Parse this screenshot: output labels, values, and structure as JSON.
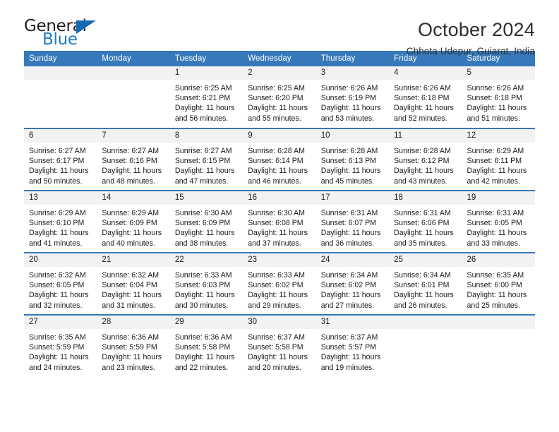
{
  "brand": {
    "name_top": "General",
    "name_bottom": "Blue",
    "accent_color": "#1569b0",
    "text_color": "#231f20"
  },
  "header": {
    "month_title": "October 2024",
    "location": "Chhota Udepur, Gujarat, India"
  },
  "theme": {
    "header_bg": "#3679ba",
    "header_text": "#ffffff",
    "daynum_bg": "#f2f2f2",
    "row_divider": "#3679ba"
  },
  "weekday_headers": [
    "Sunday",
    "Monday",
    "Tuesday",
    "Wednesday",
    "Thursday",
    "Friday",
    "Saturday"
  ],
  "labels": {
    "sunrise_prefix": "Sunrise:",
    "sunset_prefix": "Sunset:",
    "daylight_prefix": "Daylight:"
  },
  "weeks": [
    [
      {
        "day": "",
        "sunrise": "",
        "sunset": "",
        "daylight": "",
        "empty": true
      },
      {
        "day": "",
        "sunrise": "",
        "sunset": "",
        "daylight": "",
        "empty": true
      },
      {
        "day": "1",
        "sunrise": "Sunrise: 6:25 AM",
        "sunset": "Sunset: 6:21 PM",
        "daylight": "Daylight: 11 hours and 56 minutes."
      },
      {
        "day": "2",
        "sunrise": "Sunrise: 6:25 AM",
        "sunset": "Sunset: 6:20 PM",
        "daylight": "Daylight: 11 hours and 55 minutes."
      },
      {
        "day": "3",
        "sunrise": "Sunrise: 6:26 AM",
        "sunset": "Sunset: 6:19 PM",
        "daylight": "Daylight: 11 hours and 53 minutes."
      },
      {
        "day": "4",
        "sunrise": "Sunrise: 6:26 AM",
        "sunset": "Sunset: 6:18 PM",
        "daylight": "Daylight: 11 hours and 52 minutes."
      },
      {
        "day": "5",
        "sunrise": "Sunrise: 6:26 AM",
        "sunset": "Sunset: 6:18 PM",
        "daylight": "Daylight: 11 hours and 51 minutes."
      }
    ],
    [
      {
        "day": "6",
        "sunrise": "Sunrise: 6:27 AM",
        "sunset": "Sunset: 6:17 PM",
        "daylight": "Daylight: 11 hours and 50 minutes."
      },
      {
        "day": "7",
        "sunrise": "Sunrise: 6:27 AM",
        "sunset": "Sunset: 6:16 PM",
        "daylight": "Daylight: 11 hours and 48 minutes."
      },
      {
        "day": "8",
        "sunrise": "Sunrise: 6:27 AM",
        "sunset": "Sunset: 6:15 PM",
        "daylight": "Daylight: 11 hours and 47 minutes."
      },
      {
        "day": "9",
        "sunrise": "Sunrise: 6:28 AM",
        "sunset": "Sunset: 6:14 PM",
        "daylight": "Daylight: 11 hours and 46 minutes."
      },
      {
        "day": "10",
        "sunrise": "Sunrise: 6:28 AM",
        "sunset": "Sunset: 6:13 PM",
        "daylight": "Daylight: 11 hours and 45 minutes."
      },
      {
        "day": "11",
        "sunrise": "Sunrise: 6:28 AM",
        "sunset": "Sunset: 6:12 PM",
        "daylight": "Daylight: 11 hours and 43 minutes."
      },
      {
        "day": "12",
        "sunrise": "Sunrise: 6:29 AM",
        "sunset": "Sunset: 6:11 PM",
        "daylight": "Daylight: 11 hours and 42 minutes."
      }
    ],
    [
      {
        "day": "13",
        "sunrise": "Sunrise: 6:29 AM",
        "sunset": "Sunset: 6:10 PM",
        "daylight": "Daylight: 11 hours and 41 minutes."
      },
      {
        "day": "14",
        "sunrise": "Sunrise: 6:29 AM",
        "sunset": "Sunset: 6:09 PM",
        "daylight": "Daylight: 11 hours and 40 minutes."
      },
      {
        "day": "15",
        "sunrise": "Sunrise: 6:30 AM",
        "sunset": "Sunset: 6:09 PM",
        "daylight": "Daylight: 11 hours and 38 minutes."
      },
      {
        "day": "16",
        "sunrise": "Sunrise: 6:30 AM",
        "sunset": "Sunset: 6:08 PM",
        "daylight": "Daylight: 11 hours and 37 minutes."
      },
      {
        "day": "17",
        "sunrise": "Sunrise: 6:31 AM",
        "sunset": "Sunset: 6:07 PM",
        "daylight": "Daylight: 11 hours and 36 minutes."
      },
      {
        "day": "18",
        "sunrise": "Sunrise: 6:31 AM",
        "sunset": "Sunset: 6:06 PM",
        "daylight": "Daylight: 11 hours and 35 minutes."
      },
      {
        "day": "19",
        "sunrise": "Sunrise: 6:31 AM",
        "sunset": "Sunset: 6:05 PM",
        "daylight": "Daylight: 11 hours and 33 minutes."
      }
    ],
    [
      {
        "day": "20",
        "sunrise": "Sunrise: 6:32 AM",
        "sunset": "Sunset: 6:05 PM",
        "daylight": "Daylight: 11 hours and 32 minutes."
      },
      {
        "day": "21",
        "sunrise": "Sunrise: 6:32 AM",
        "sunset": "Sunset: 6:04 PM",
        "daylight": "Daylight: 11 hours and 31 minutes."
      },
      {
        "day": "22",
        "sunrise": "Sunrise: 6:33 AM",
        "sunset": "Sunset: 6:03 PM",
        "daylight": "Daylight: 11 hours and 30 minutes."
      },
      {
        "day": "23",
        "sunrise": "Sunrise: 6:33 AM",
        "sunset": "Sunset: 6:02 PM",
        "daylight": "Daylight: 11 hours and 29 minutes."
      },
      {
        "day": "24",
        "sunrise": "Sunrise: 6:34 AM",
        "sunset": "Sunset: 6:02 PM",
        "daylight": "Daylight: 11 hours and 27 minutes."
      },
      {
        "day": "25",
        "sunrise": "Sunrise: 6:34 AM",
        "sunset": "Sunset: 6:01 PM",
        "daylight": "Daylight: 11 hours and 26 minutes."
      },
      {
        "day": "26",
        "sunrise": "Sunrise: 6:35 AM",
        "sunset": "Sunset: 6:00 PM",
        "daylight": "Daylight: 11 hours and 25 minutes."
      }
    ],
    [
      {
        "day": "27",
        "sunrise": "Sunrise: 6:35 AM",
        "sunset": "Sunset: 5:59 PM",
        "daylight": "Daylight: 11 hours and 24 minutes."
      },
      {
        "day": "28",
        "sunrise": "Sunrise: 6:36 AM",
        "sunset": "Sunset: 5:59 PM",
        "daylight": "Daylight: 11 hours and 23 minutes."
      },
      {
        "day": "29",
        "sunrise": "Sunrise: 6:36 AM",
        "sunset": "Sunset: 5:58 PM",
        "daylight": "Daylight: 11 hours and 22 minutes."
      },
      {
        "day": "30",
        "sunrise": "Sunrise: 6:37 AM",
        "sunset": "Sunset: 5:58 PM",
        "daylight": "Daylight: 11 hours and 20 minutes."
      },
      {
        "day": "31",
        "sunrise": "Sunrise: 6:37 AM",
        "sunset": "Sunset: 5:57 PM",
        "daylight": "Daylight: 11 hours and 19 minutes."
      },
      {
        "day": "",
        "sunrise": "",
        "sunset": "",
        "daylight": "",
        "empty": true
      },
      {
        "day": "",
        "sunrise": "",
        "sunset": "",
        "daylight": "",
        "empty": true
      }
    ]
  ]
}
